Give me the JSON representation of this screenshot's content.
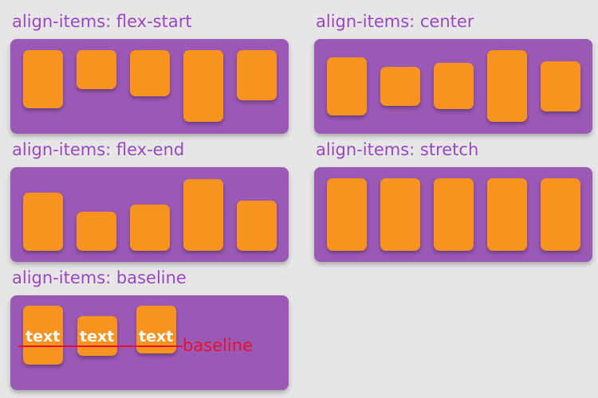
{
  "colors": {
    "background": "#e6e6e6",
    "title": "#9b47c4",
    "panel": "#9b59b6",
    "box": "#f7931e",
    "box_text": "#ffffff",
    "baseline": "#e8102a"
  },
  "sections": {
    "flex_start": {
      "title": "align-items: flex-start"
    },
    "center": {
      "title": "align-items: center"
    },
    "flex_end": {
      "title": "align-items: flex-end"
    },
    "stretch": {
      "title": "align-items: stretch"
    },
    "baseline": {
      "title": "align-items: baseline",
      "item_texts": [
        "text",
        "text",
        "text"
      ],
      "baseline_label": "baseline"
    }
  }
}
